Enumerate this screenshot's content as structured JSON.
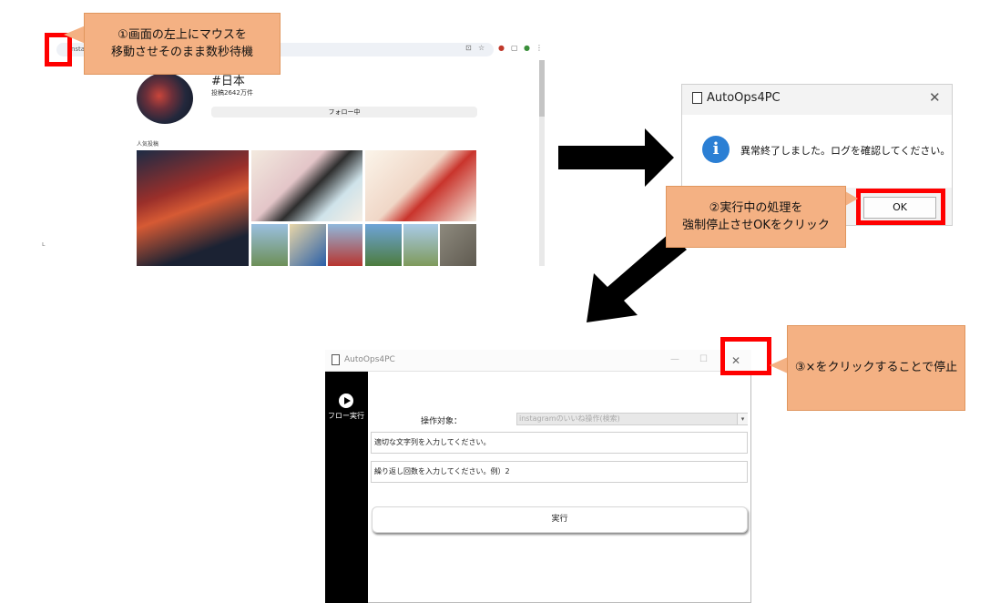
{
  "browser": {
    "url": "instagram.com",
    "hashtag": "#日本",
    "post_count": "投稿2642万件",
    "follow_button": "フォロー中",
    "popular_label": "人気投稿"
  },
  "callouts": {
    "step1_line1": "①画面の左上にマウスを",
    "step1_line2": "移動させそのまま数秒待機",
    "step2_line1": "②実行中の処理を",
    "step2_line2": "強制停止させOKをクリック",
    "step3": "③×をクリックすることで停止"
  },
  "dialog": {
    "title": "AutoOps4PC",
    "message": "異常終了しました。ログを確認してください。",
    "ok_label": "OK",
    "close_symbol": "✕",
    "icon_letter": "i"
  },
  "app": {
    "title": "AutoOps4PC",
    "sidebar_label": "フロー実行",
    "operation_label": "操作対象：",
    "operation_value": "instagramのいいね操作(検索)",
    "field1_placeholder": "適切な文字列を入力してください。",
    "field2_placeholder": "繰り返し回数を入力してください。例）2",
    "run_label": "実行",
    "min_symbol": "—",
    "max_symbol": "☐",
    "close_symbol": "✕"
  },
  "colors": {
    "callout_fill": "#f4b183",
    "highlight": "#ff0000",
    "info_blue": "#2b7fd4",
    "arrow": "#000000"
  }
}
